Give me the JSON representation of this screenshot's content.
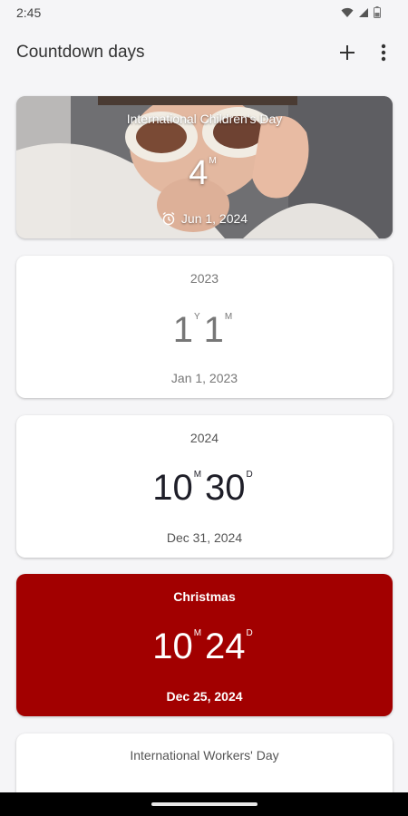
{
  "status_bar": {
    "time": "2:45"
  },
  "app_bar": {
    "title": "Countdown days",
    "add_icon": "plus-icon",
    "more_icon": "more-vert-icon"
  },
  "cards": [
    {
      "title": "International Children's Day",
      "parts": [
        {
          "value": "4",
          "unit": "M"
        }
      ],
      "date": "Jun 1, 2024",
      "date_icon": "alarm-clock-icon",
      "style": "photo"
    },
    {
      "title": "2023",
      "parts": [
        {
          "value": "1",
          "unit": "Y"
        },
        {
          "value": "1",
          "unit": "M"
        }
      ],
      "date": "Jan 1, 2023",
      "style": "past"
    },
    {
      "title": "2024",
      "parts": [
        {
          "value": "10",
          "unit": "M"
        },
        {
          "value": "30",
          "unit": "D"
        }
      ],
      "date": "Dec 31, 2024",
      "style": "default"
    },
    {
      "title": "Christmas",
      "parts": [
        {
          "value": "10",
          "unit": "M"
        },
        {
          "value": "24",
          "unit": "D"
        }
      ],
      "date": "Dec 25, 2024",
      "style": "colored",
      "color": "#a20000"
    },
    {
      "title": "International Workers' Day",
      "style": "default"
    }
  ],
  "colors": {
    "background": "#f5f5f7",
    "card": "#ffffff",
    "christmas_card": "#a20000"
  }
}
